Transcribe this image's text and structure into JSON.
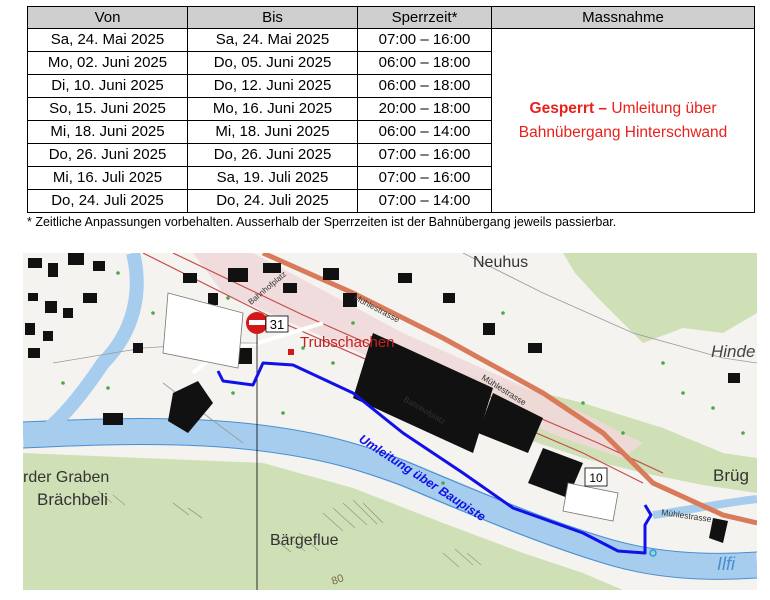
{
  "table": {
    "headers": [
      "Von",
      "Bis",
      "Sperrzeit*",
      "Massnahme"
    ],
    "rows": [
      [
        "Sa, 24. Mai 2025",
        "Sa, 24. Mai 2025",
        "07:00 – 16:00"
      ],
      [
        "Mo, 02. Juni 2025",
        "Do, 05. Juni 2025",
        "06:00 – 18:00"
      ],
      [
        "Di, 10. Juni 2025",
        "Do, 12. Juni 2025",
        "06:00 – 18:00"
      ],
      [
        "So, 15. Juni 2025",
        "Mo, 16. Juni 2025",
        "20:00 – 18:00"
      ],
      [
        "Mi, 18. Juni 2025",
        "Mi, 18. Juni 2025",
        "06:00 – 14:00"
      ],
      [
        "Do, 26. Juni 2025",
        "Do, 26. Juni 2025",
        "07:00 – 16:00"
      ],
      [
        "Mi, 16. Juli 2025",
        "Sa, 19. Juli 2025",
        "07:00 – 16:00"
      ],
      [
        "Do, 24. Juli 2025",
        "Do, 24. Juli 2025",
        "07:00 – 14:00"
      ]
    ],
    "massnahme_bold": "Gesperrt –",
    "massnahme_text": " Umleitung über Bahnübergang Hinterschwand"
  },
  "footnote": "* Zeitliche Anpassungen vorbehalten. Ausserhalb der Sperrzeiten ist der Bahnübergang jeweils passierbar.",
  "map": {
    "labels": {
      "neuhus": "Neuhus",
      "hinde": "Hinde",
      "trubschachen": "Trubschachen",
      "rder_graben": "rder Graben",
      "brachbeli": "Brächbeli",
      "bargeflue": "Bärgeflue",
      "brug": "Brüg",
      "ilfi": "Ilfi",
      "muehlestrasse_1": "Mühlestrasse",
      "muehlestrasse_2": "Mühlestrasse",
      "muehlestrasse_3": "Mühlestrasse",
      "bahnhofplatz_1": "Bahnhofplatz",
      "bahnhofplatz_2": "Bahnhofplatz",
      "route": "Umleitung über Baupiste",
      "road_sign_31": "31",
      "road_sign_10": "10",
      "contour_80": "80"
    },
    "colors": {
      "route": "#1010e8",
      "river": "#a6cdee",
      "forest": "#cfe0b6",
      "road": "#d97a5a",
      "station": "#d21818"
    }
  }
}
